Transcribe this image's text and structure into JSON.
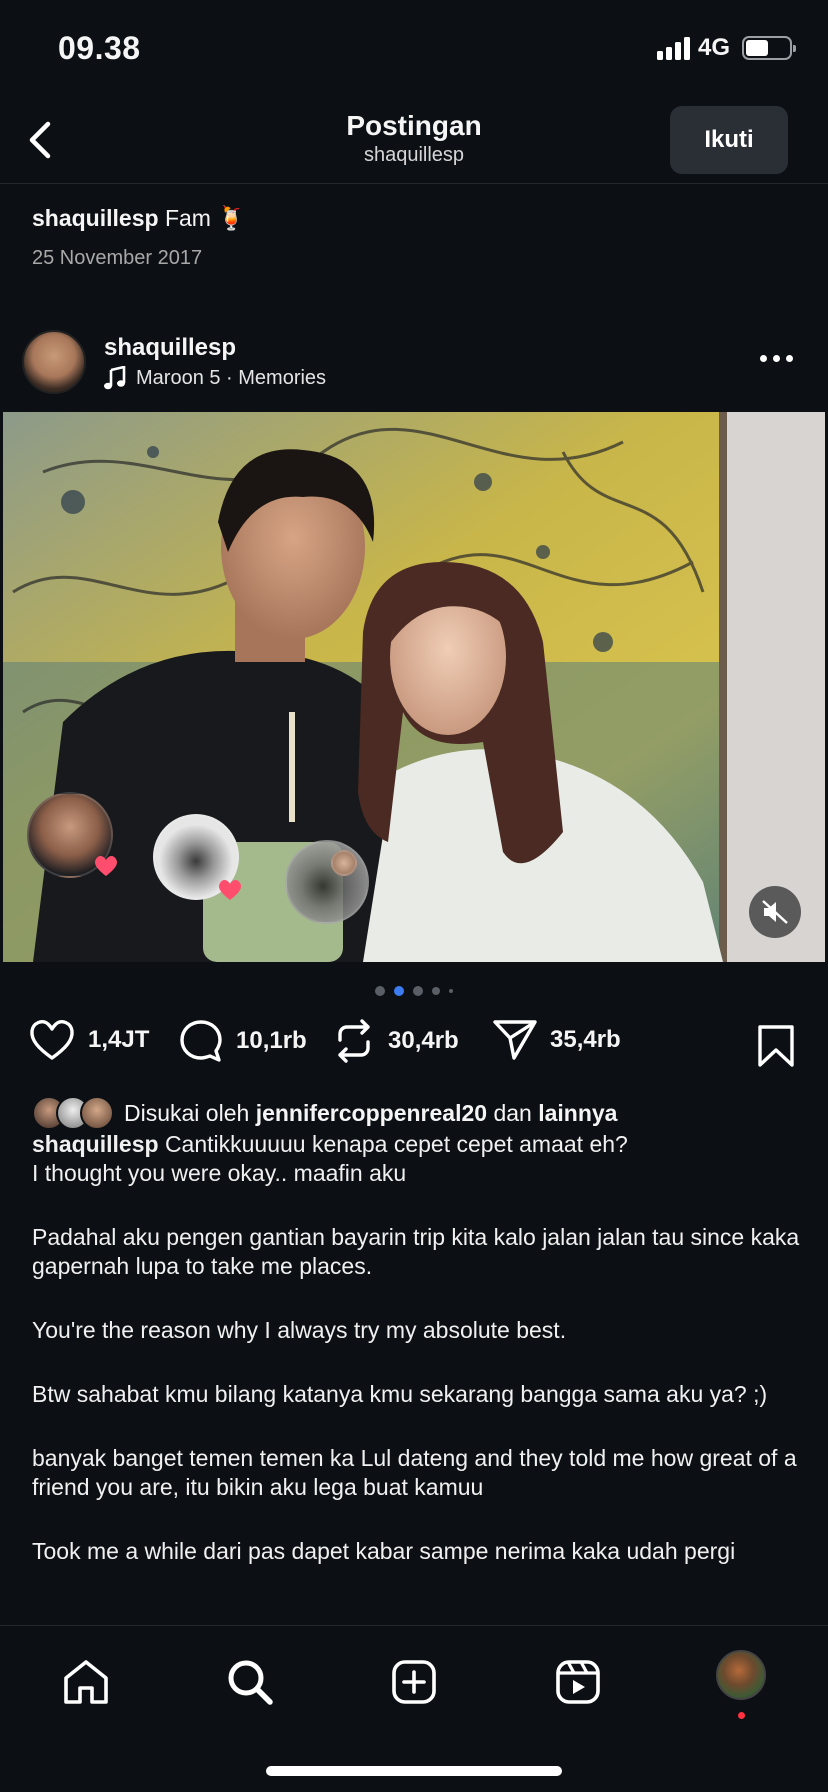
{
  "status": {
    "time": "09.38",
    "network": "4G"
  },
  "nav": {
    "title": "Postingan",
    "subtitle": "shaquillesp",
    "follow_label": "Ikuti",
    "back_icon": "chevron-left-icon"
  },
  "caption_header": {
    "username": "shaquillesp",
    "text": "Fam 🍹",
    "date": "25 November 2017"
  },
  "post": {
    "username": "shaquillesp",
    "music": "Maroon 5 · Memories",
    "music_icon": "music-note-icon"
  },
  "carousel": {
    "count": 5,
    "active_index": 1
  },
  "actions": {
    "likes": "1,4JT",
    "comments": "10,1rb",
    "reposts": "30,4rb",
    "shares": "35,4rb"
  },
  "liked_by": {
    "prefix": "Disukai oleh",
    "user": "jennifercoppenreal20",
    "conj": "dan",
    "others": "lainnya"
  },
  "caption": {
    "username": "shaquillesp",
    "first_line": "Cantikkuuuuu kenapa cepet cepet amaat eh?",
    "paragraphs": [
      "I thought you were okay.. maafin aku",
      "Padahal aku pengen gantian bayarin trip kita kalo jalan jalan tau since kaka gapernah lupa to take me places.",
      "You're the reason why I always try my absolute best.",
      "Btw sahabat kmu bilang katanya kmu sekarang bangga sama aku ya? ;)",
      "banyak banget temen temen ka Lul dateng and they told me how great of a friend you are, itu bikin aku lega buat kamuu",
      "Took me a while dari pas dapet kabar sampe nerima kaka udah pergi"
    ]
  },
  "tabbar": {
    "items": [
      "home-icon",
      "search-icon",
      "create-icon",
      "reels-icon",
      "profile-avatar"
    ]
  },
  "colors": {
    "background": "#0c1014",
    "text": "#f5f5f5",
    "muted": "#a8a8a8",
    "active_dot": "#3d7cf0",
    "notification": "#ff3040"
  }
}
